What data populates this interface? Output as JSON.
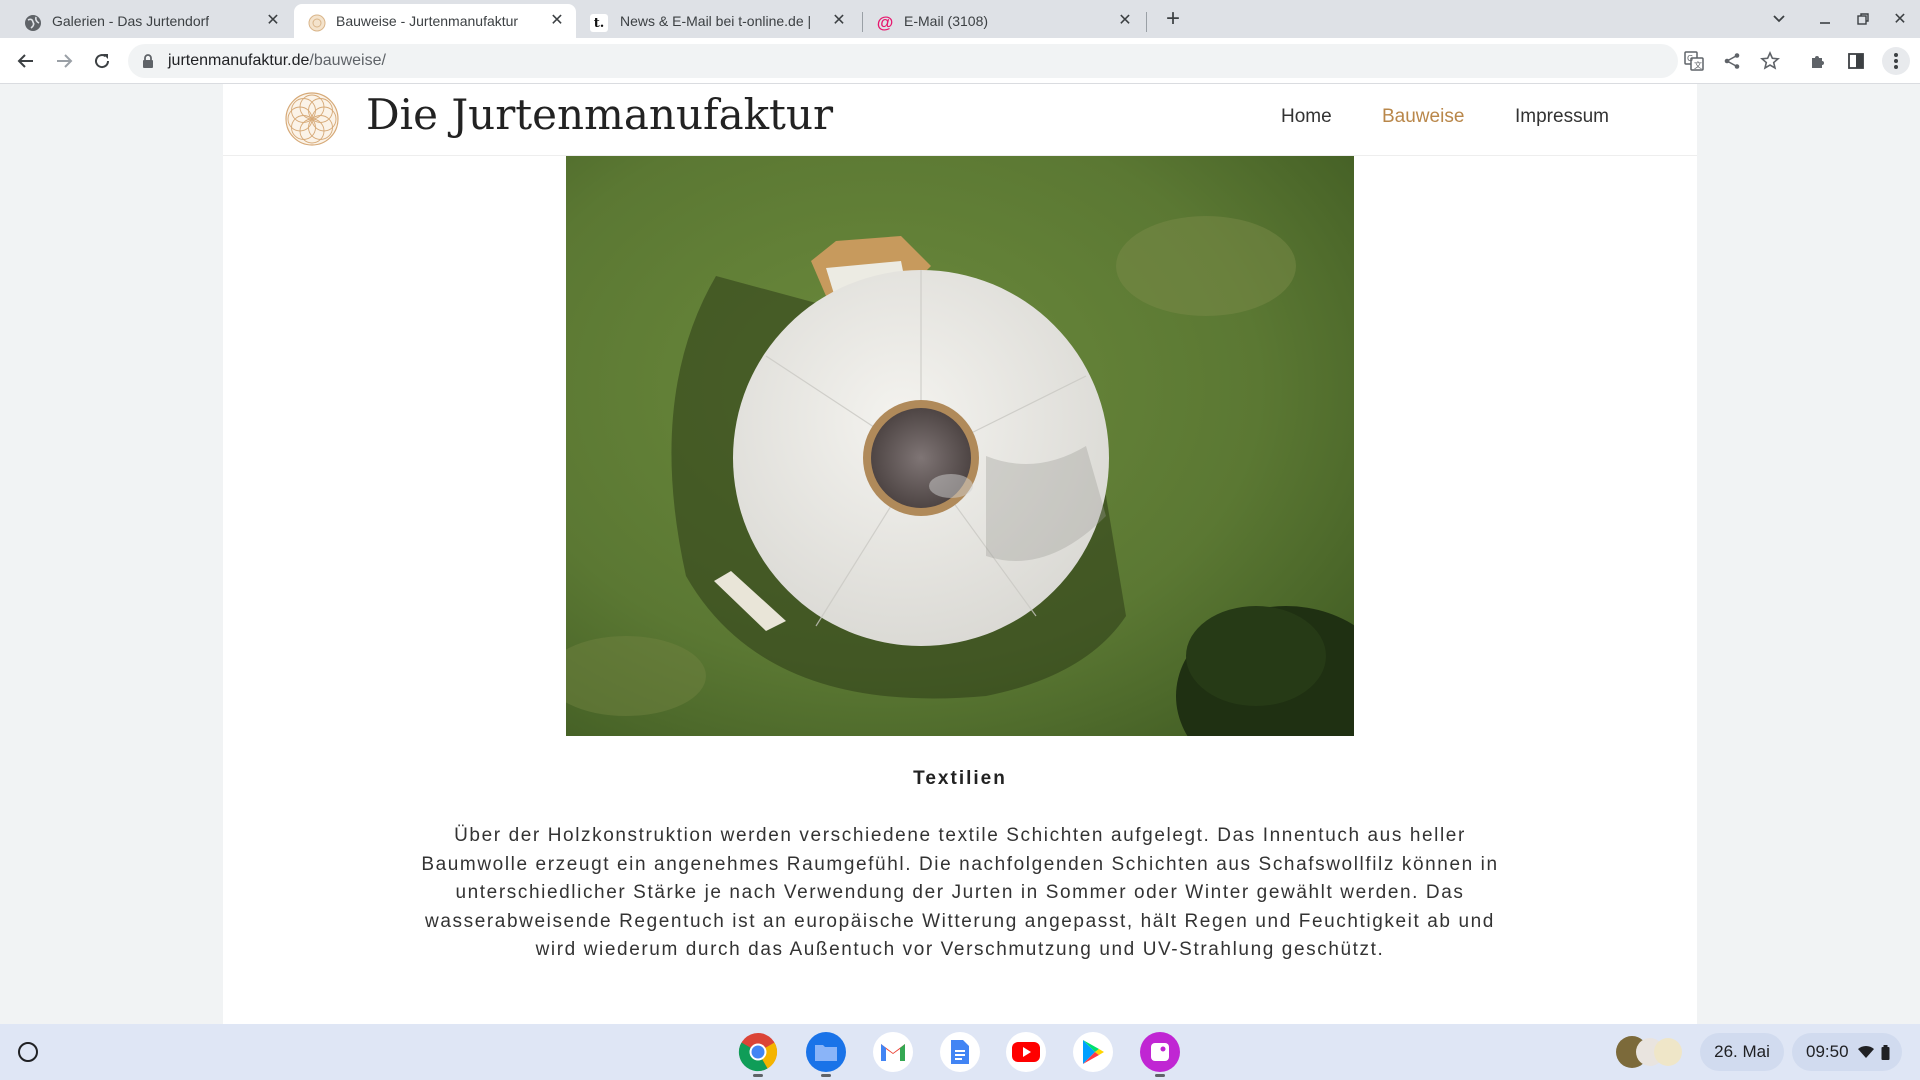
{
  "browser": {
    "tabs": [
      {
        "title": "Galerien - Das Jurtendorf",
        "active": false,
        "favicon": "globe-icon"
      },
      {
        "title": "Bauweise - Jurtenmanufaktur",
        "active": true,
        "favicon": "mandala-icon"
      },
      {
        "title": "News & E-Mail bei t-online.de | Pc",
        "active": false,
        "favicon": "t-online-icon"
      },
      {
        "title": "E-Mail (3108)",
        "active": false,
        "favicon": "at-sign-icon"
      }
    ],
    "url_domain": "jurtenmanufaktur.de",
    "url_path": "/bauweise/"
  },
  "site": {
    "title": "Die Jurtenmanufaktur",
    "nav": [
      {
        "label": "Home",
        "current": false
      },
      {
        "label": "Bauweise",
        "current": true
      },
      {
        "label": "Impressum",
        "current": false
      }
    ],
    "accent_color": "#b9874a"
  },
  "content": {
    "hero_image": "aerial-view-of-yurt-on-grass",
    "heading": "Textilien",
    "paragraph": "Über der Holzkonstruktion werden verschiedene textile Schichten aufgelegt. Das Innentuch aus heller Baumwolle erzeugt ein angenehmes Raumgefühl. Die nachfolgenden Schichten aus Schafswollfilz können in unterschiedlicher Stärke je nach Verwendung der Jurten in Sommer oder Winter gewählt werden. Das wasserabweisende Regentuch ist an europäische Witterung angepasst, hält Regen und Feuchtigkeit ab und wird wiederum durch das Außentuch vor Verschmutzung und UV-Strahlung geschützt."
  },
  "shelf": {
    "apps": [
      "chrome-icon",
      "files-icon",
      "gmail-icon",
      "docs-icon",
      "youtube-icon",
      "play-store-icon",
      "gallery-icon"
    ],
    "date": "26. Mai",
    "time": "09:50"
  }
}
